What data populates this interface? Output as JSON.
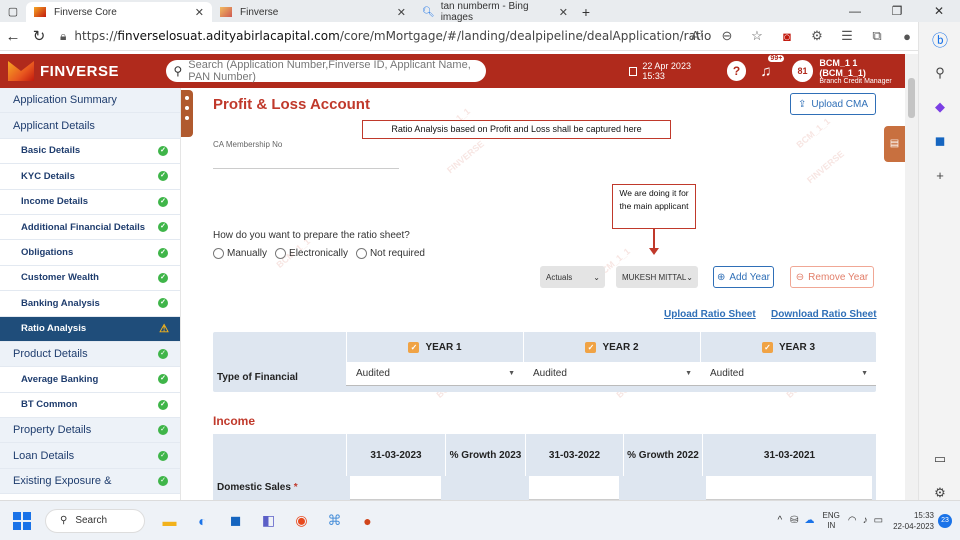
{
  "browser": {
    "tabs": [
      {
        "label": "Finverse Core"
      },
      {
        "label": "Finverse"
      },
      {
        "label": "tan numberm - Bing images"
      }
    ],
    "url_prefix": "https://",
    "url_domain": "finverselosuat.adityabirlacapital.com",
    "url_path": "/core/mMortgage/#/landing/dealpipeline/dealApplication/ratio"
  },
  "header": {
    "brand": "FINVERSE",
    "search_placeholder": "Search (Application Number,Finverse ID, Applicant Name, PAN Number)",
    "datetime": "22 Apr 2023 15:33",
    "help": "?",
    "notif_badge": "99+",
    "avatar": "81",
    "user_name": "BCM_1 1 (BCM_1_1)",
    "user_role": "Branch Credit Manager"
  },
  "sidebar": {
    "items": [
      {
        "label": "Application Summary"
      },
      {
        "label": "Applicant Details"
      },
      {
        "label": "Basic Details"
      },
      {
        "label": "KYC Details"
      },
      {
        "label": "Income Details"
      },
      {
        "label": "Additional Financial Details"
      },
      {
        "label": "Obligations"
      },
      {
        "label": "Customer Wealth"
      },
      {
        "label": "Banking Analysis"
      },
      {
        "label": "Ratio Analysis"
      },
      {
        "label": "Product Details"
      },
      {
        "label": "Average Banking"
      },
      {
        "label": "BT Common"
      },
      {
        "label": "Property Details"
      },
      {
        "label": "Loan Details"
      },
      {
        "label": "Existing Exposure &"
      }
    ]
  },
  "main": {
    "title": "Profit & Loss Account",
    "upload_cma": "Upload CMA",
    "callout_ratio": "Ratio Analysis based on Profit and Loss shall be captured here",
    "ca_label": "CA Membership No",
    "callout_main": "We are doing it for the main applicant",
    "prep_question": "How do you want to prepare the ratio sheet?",
    "radio_options": [
      "Manually",
      "Electronically",
      "Not required"
    ],
    "actuals": "Actuals",
    "applicant": "MUKESH MITTAL",
    "add_year": "Add Year",
    "remove_year": "Remove Year",
    "upload_ratio": "Upload Ratio Sheet",
    "download_ratio": "Download Ratio Sheet",
    "watermark": "BCM_1_1",
    "watermark2": "FINVERSE",
    "years": [
      "YEAR 1",
      "YEAR 2",
      "YEAR 3"
    ],
    "type_label": "Type of Financial",
    "type_values": [
      "Audited",
      "Audited",
      "Audited"
    ],
    "income_title": "Income",
    "income_headers": [
      "31-03-2023",
      "% Growth 2023",
      "31-03-2022",
      "% Growth 2022",
      "31-03-2021"
    ],
    "domestic_sales": "Domestic Sales",
    "required_mark": "*"
  },
  "taskbar": {
    "search": "Search",
    "lang1": "ENG",
    "lang2": "IN",
    "time": "15:33",
    "date": "22-04-2023",
    "notif": "23"
  }
}
